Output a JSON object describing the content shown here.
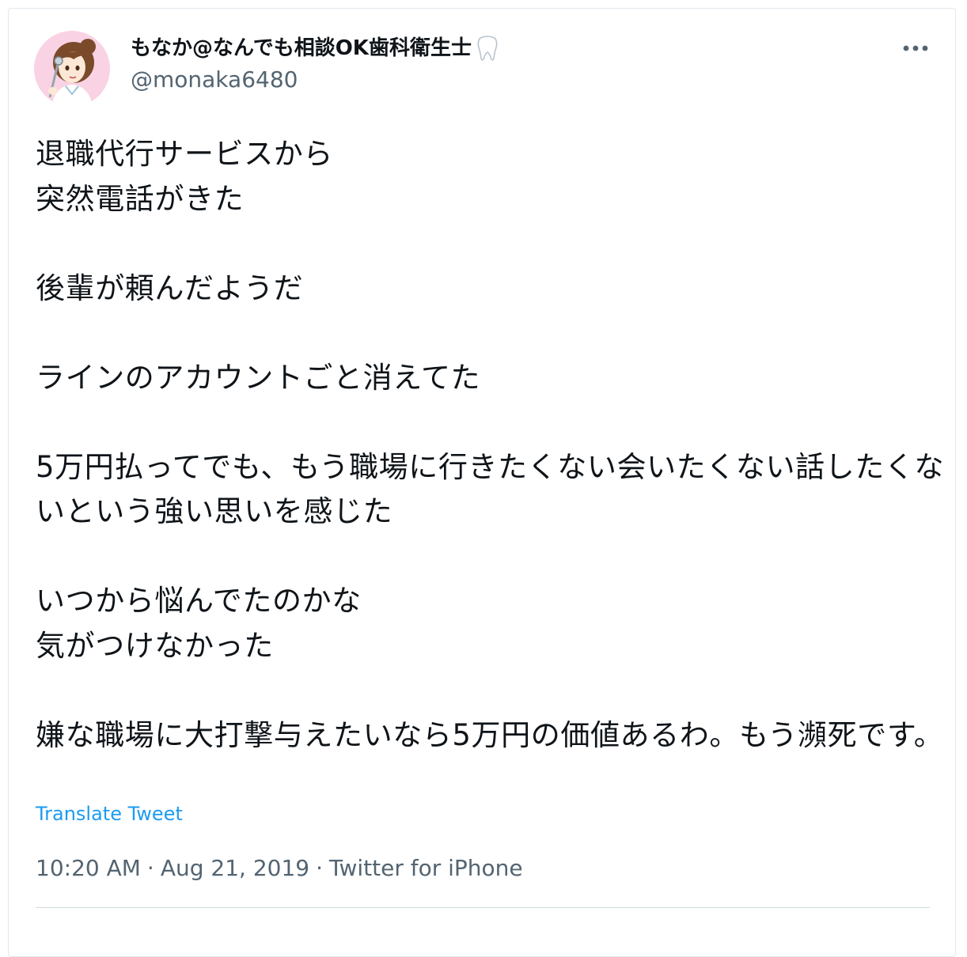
{
  "tweet": {
    "author": {
      "display_name": "もなか@なんでも相談OK歯科衛生士",
      "handle": "@monaka6480",
      "avatar_icon": "avatar-dental-hygienist-illustration",
      "name_emoji_icon": "tooth-icon"
    },
    "more_icon": "more-dots-icon",
    "text": "退職代行サービスから\n突然電話がきた\n\n後輩が頼んだようだ\n\nラインのアカウントごと消えてた\n\n5万円払ってでも、もう職場に行きたくない会いたくない話したくないという強い思いを感じた\n\nいつから悩んでたのかな\n気がつけなかった\n\n嫌な職場に大打撃与えたいなら5万円の価値あるわ。もう瀕死です。",
    "translate_label": "Translate Tweet",
    "time": "10:20 AM",
    "date": "Aug 21, 2019",
    "source": "Twitter for iPhone",
    "separator": "·"
  },
  "colors": {
    "link": "#1d9bf0",
    "muted": "#536471",
    "text": "#0f1419",
    "border": "#e1e8ed"
  }
}
